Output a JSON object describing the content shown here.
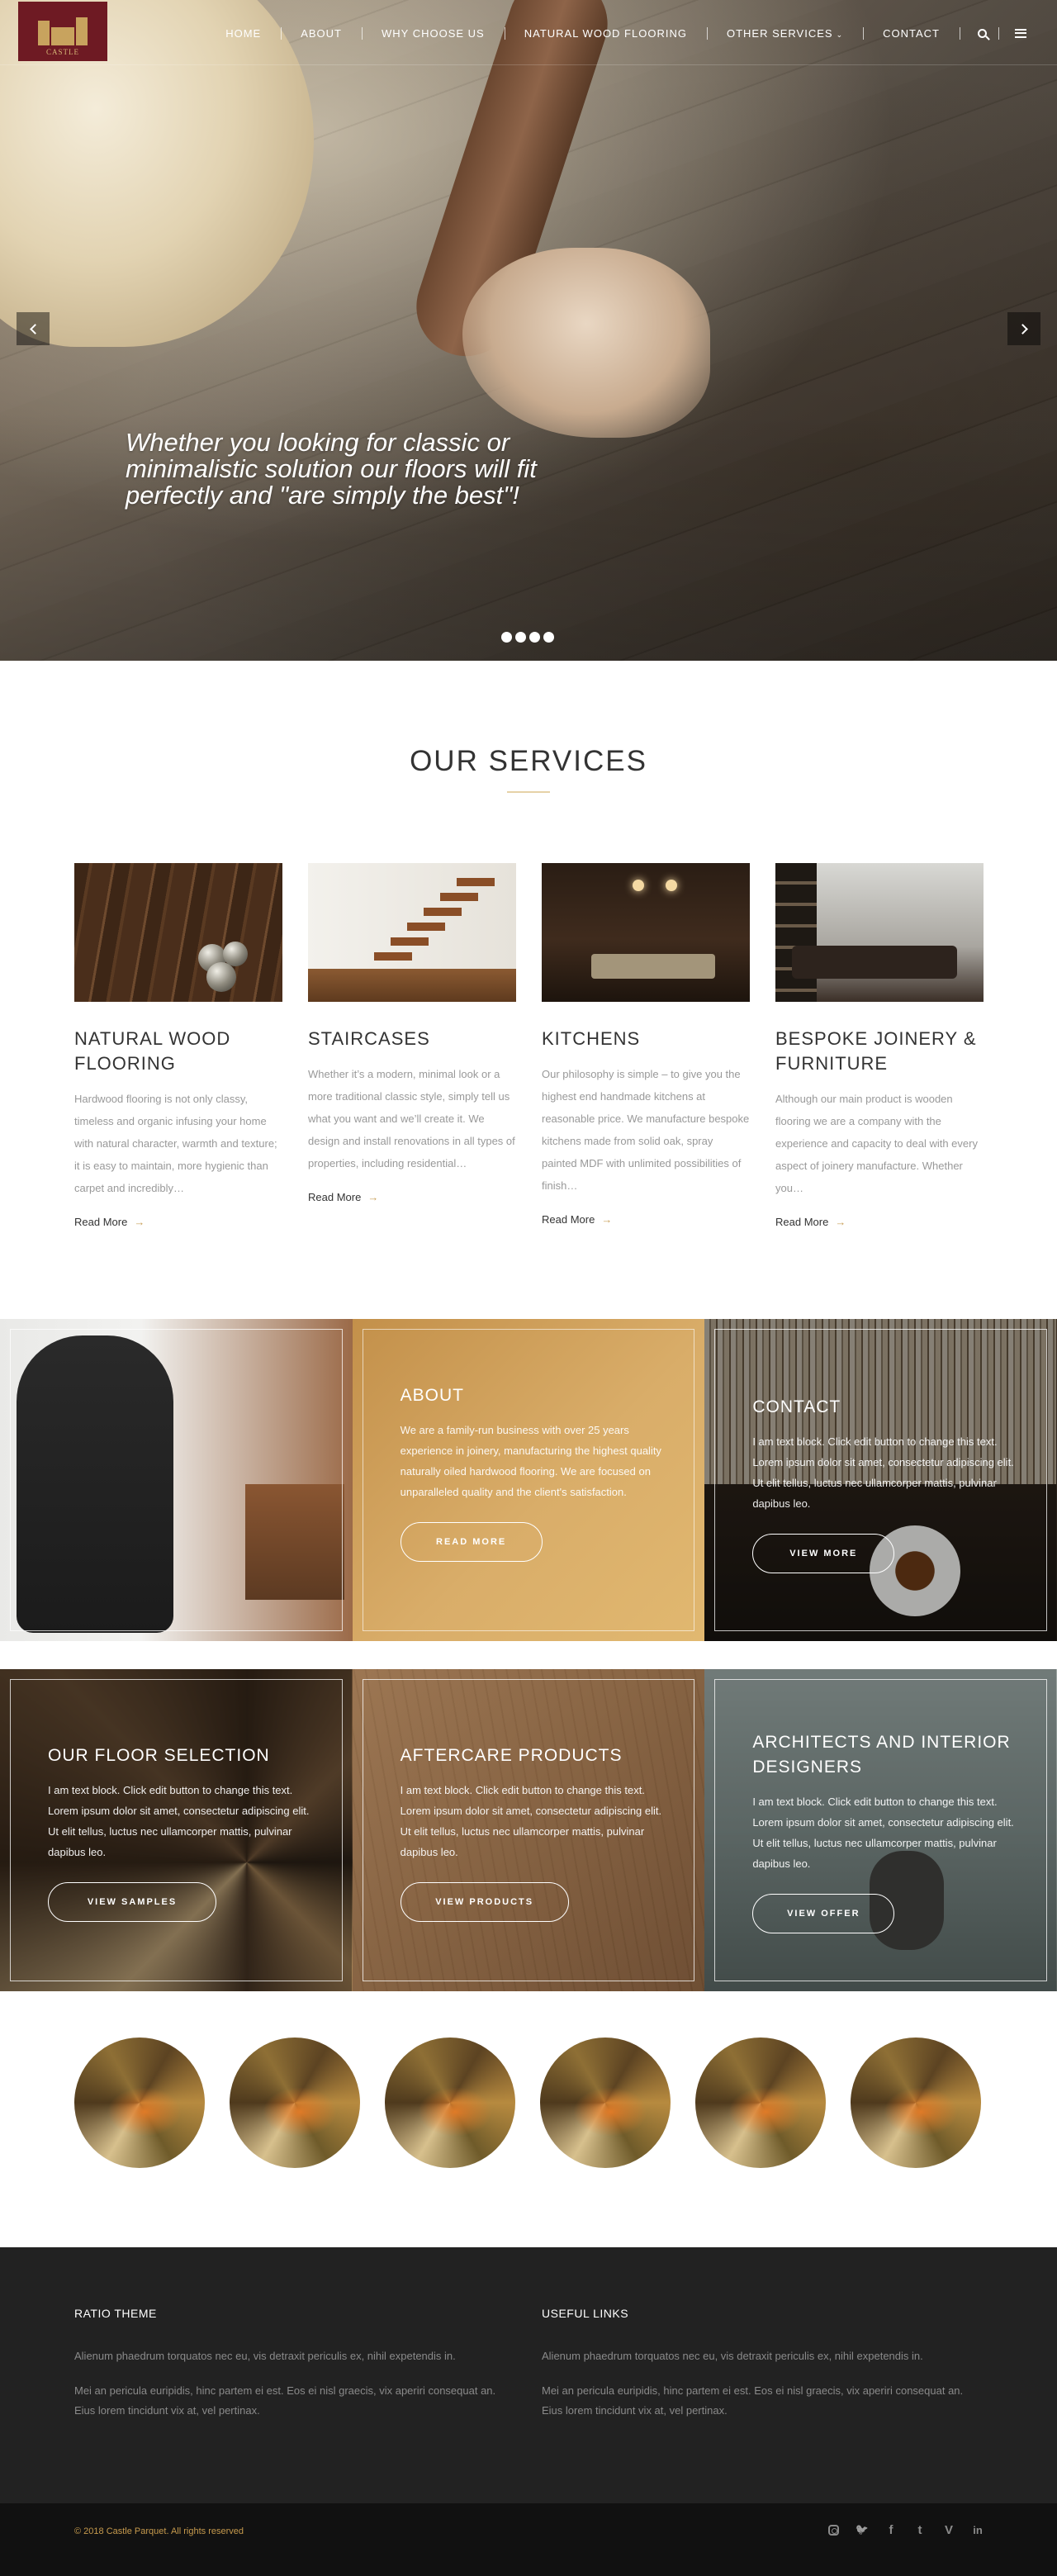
{
  "header": {
    "logo_text": "CASTLE",
    "nav": [
      {
        "label": "HOME"
      },
      {
        "label": "ABOUT"
      },
      {
        "label": "WHY CHOOSE US"
      },
      {
        "label": "NATURAL WOOD FLOORING"
      },
      {
        "label": "OTHER SERVICES"
      },
      {
        "label": "CONTACT"
      }
    ]
  },
  "hero": {
    "caption": "Whether you looking for classic or minimalistic solution our floors will fit perfectly and \"are simply the best\"!",
    "slide_count": 4
  },
  "services": {
    "title": "OUR SERVICES",
    "read_more": "Read More",
    "items": [
      {
        "title": "NATURAL WOOD FLOORING",
        "text": "Hardwood flooring is not only classy, timeless and organic infusing your home with natural character, warmth and texture; it is easy to maintain, more hygienic than carpet and incredibly…"
      },
      {
        "title": "STAIRCASES",
        "text": "Whether it’s a modern, minimal look or a more traditional classic style, simply tell us what you want and we’ll create it. We design and install renovations in all types of properties, including residential…"
      },
      {
        "title": "KITCHENS",
        "text": "Our philosophy is simple – to give you the highest end handmade kitchens at reasonable price. We manufacture bespoke kitchens made from solid oak, spray painted MDF with unlimited possibilities of finish…"
      },
      {
        "title": "BESPOKE JOINERY & FURNITURE",
        "text": "Although our main product is wooden flooring we are a company with the experience and capacity to deal with every aspect of joinery manufacture. Whether you…"
      }
    ]
  },
  "tiles_row1": {
    "about": {
      "title": "ABOUT",
      "text": "We are a family-run business with over 25 years experience in joinery, manufacturing the highest quality naturally oiled hardwood flooring. We are focused on unparalleled quality and the client's satisfaction.",
      "button": "READ MORE"
    },
    "contact": {
      "title": "CONTACT",
      "text": "I am text block. Click edit button to change this text. Lorem ipsum dolor sit amet, consectetur adipiscing elit. Ut elit tellus, luctus nec ullamcorper mattis, pulvinar dapibus leo.",
      "button": "VIEW MORE"
    }
  },
  "tiles_row2": {
    "floor": {
      "title": "OUR FLOOR SELECTION",
      "text": "I am text block. Click edit button to change this text. Lorem ipsum dolor sit amet, consectetur adipiscing elit. Ut elit tellus, luctus nec ullamcorper mattis, pulvinar dapibus leo.",
      "button": "VIEW SAMPLES"
    },
    "aftercare": {
      "title": "AFTERCARE PRODUCTS",
      "text": "I am text block. Click edit button to change this text. Lorem ipsum dolor sit amet, consectetur adipiscing elit. Ut elit tellus, luctus nec ullamcorper mattis, pulvinar dapibus leo.",
      "button": "VIEW PRODUCTS"
    },
    "architects": {
      "title": "ARCHITECTS AND INTERIOR DESIGNERS",
      "text": "I am text block. Click edit button to change this text. Lorem ipsum dolor sit amet, consectetur adipiscing elit. Ut elit tellus, luctus nec ullamcorper mattis, pulvinar dapibus leo.",
      "button": "VIEW OFFER"
    }
  },
  "gallery": {
    "count": 6
  },
  "footer": {
    "col1": {
      "heading": "RATIO THEME",
      "p1": "Alienum phaedrum torquatos nec eu, vis detraxit periculis ex, nihil expetendis in.",
      "p2": "Mei an pericula euripidis, hinc partem ei est. Eos ei nisl graecis, vix aperiri consequat an. Eius lorem tincidunt vix at, vel pertinax."
    },
    "col2": {
      "heading": "USEFUL LINKS",
      "p1": "Alienum phaedrum torquatos nec eu, vis detraxit periculis ex, nihil expetendis in.",
      "p2": "Mei an pericula euripidis, hinc partem ei est. Eos ei nisl graecis, vix aperiri consequat an. Eius lorem tincidunt vix at, vel pertinax."
    },
    "copyright": "© 2018 Castle Parquet. All rights reserved",
    "social": [
      "instagram-icon",
      "twitter-icon",
      "facebook-icon",
      "tumblr-icon",
      "vimeo-icon",
      "linkedin-icon"
    ],
    "social_glyphs": {
      "twitter": "🐦",
      "facebook": "f",
      "tumblr": "t",
      "vimeo": "V",
      "linkedin": "in"
    }
  }
}
